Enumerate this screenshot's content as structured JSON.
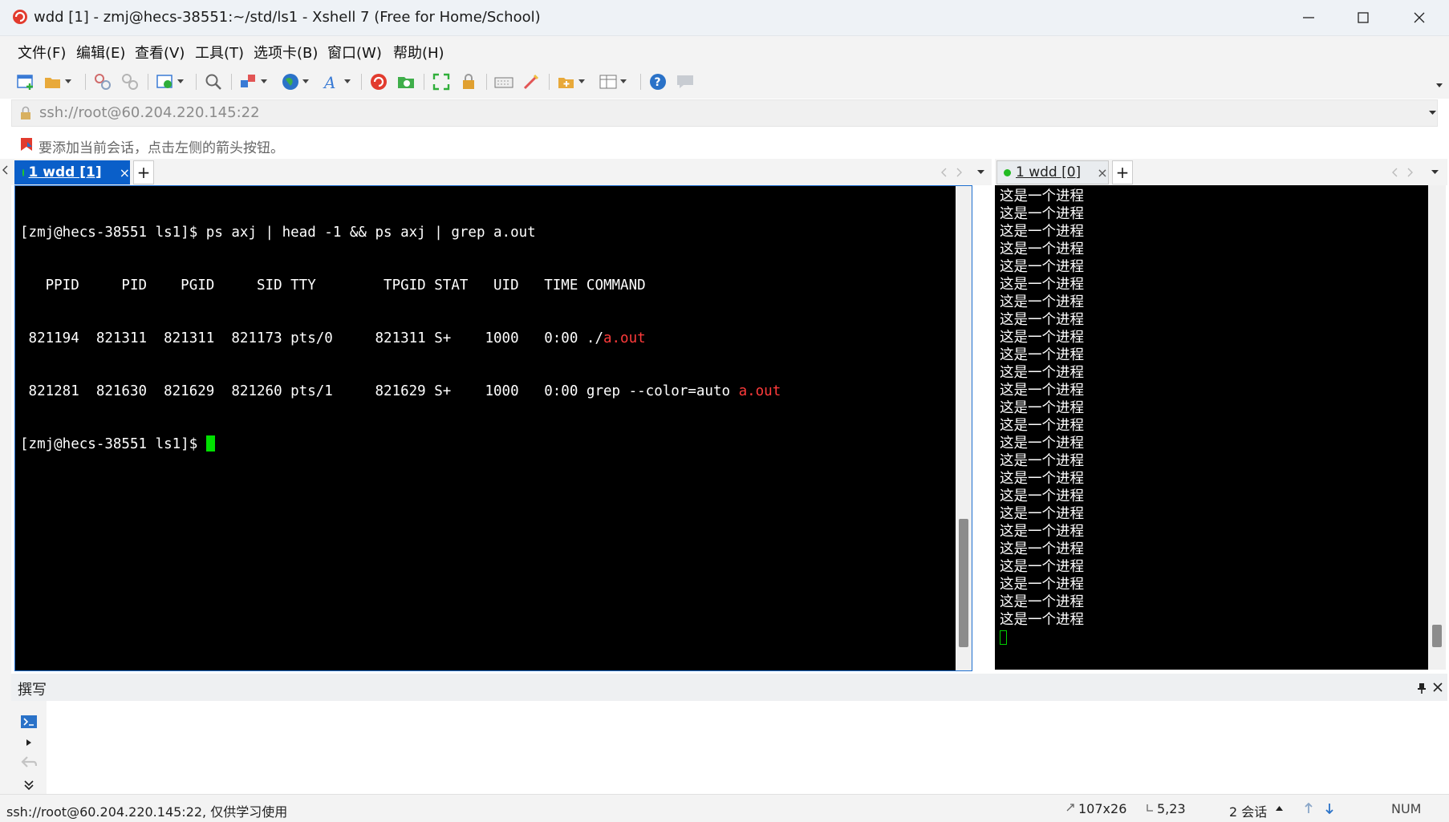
{
  "window": {
    "title": "wdd [1] - zmj@hecs-38551:~/std/ls1 - Xshell 7 (Free for Home/School)",
    "min_icon": "minimize-icon",
    "max_icon": "maximize-icon",
    "close_icon": "close-icon"
  },
  "menu": [
    {
      "label": "文件(F)"
    },
    {
      "label": "编辑(E)"
    },
    {
      "label": "查看(V)"
    },
    {
      "label": "工具(T)"
    },
    {
      "label": "选项卡(B)"
    },
    {
      "label": "窗口(W)"
    },
    {
      "label": "帮助(H)"
    }
  ],
  "toolbar_icons": [
    "new-session-icon",
    "open-folder-icon",
    "reconnect-icon",
    "disconnect-icon",
    "properties-icon",
    "search-icon",
    "transfer-icon",
    "globe-icon",
    "font-icon",
    "xshell-icon",
    "xftp-icon",
    "fullscreen-icon",
    "lock-icon",
    "keyboard-icon",
    "script-icon",
    "add-folder-icon",
    "layout-icon",
    "help-icon",
    "chat-icon"
  ],
  "address": {
    "text": "ssh://root@60.204.220.145:22",
    "icon": "lock-icon"
  },
  "hint": {
    "text": "要添加当前会话，点击左侧的箭头按钮。",
    "icon": "bookmark-flag-icon"
  },
  "left_pane": {
    "tab_label": "1 wdd [1]",
    "tab_close": "×",
    "add_tab": "+",
    "lines": [
      {
        "text": "[zmj@hecs-38551 ls1]$ ps axj | head -1 && ps axj | grep a.out"
      },
      {
        "text": "   PPID     PID    PGID     SID TTY        TPGID STAT   UID   TIME COMMAND"
      },
      {
        "text": " 821194  821311  821311  821173 pts/0     821311 S+    1000   0:00 ./",
        "hl": "a.out"
      },
      {
        "text": " 821281  821630  821629  821260 pts/1     821629 S+    1000   0:00 grep --color=auto ",
        "hl": "a.out"
      },
      {
        "text": "[zmj@hecs-38551 ls1]$ ",
        "cursor": true
      }
    ],
    "highlight_color": "#ff3b3b",
    "cursor_color": "#00e000"
  },
  "right_pane": {
    "tab_label": "1 wdd [0]",
    "tab_close": "×",
    "add_tab": "+",
    "line_text": "这是一个进程",
    "line_count": 25,
    "status_dot_color": "#22bb22"
  },
  "compose": {
    "title": "撰写"
  },
  "status": {
    "connection": "ssh://root@60.204.220.145:22, 仅供学习使用",
    "size": "107x26",
    "cursor_pos": "5,23",
    "sessions": "2 会话",
    "num": "NUM"
  }
}
